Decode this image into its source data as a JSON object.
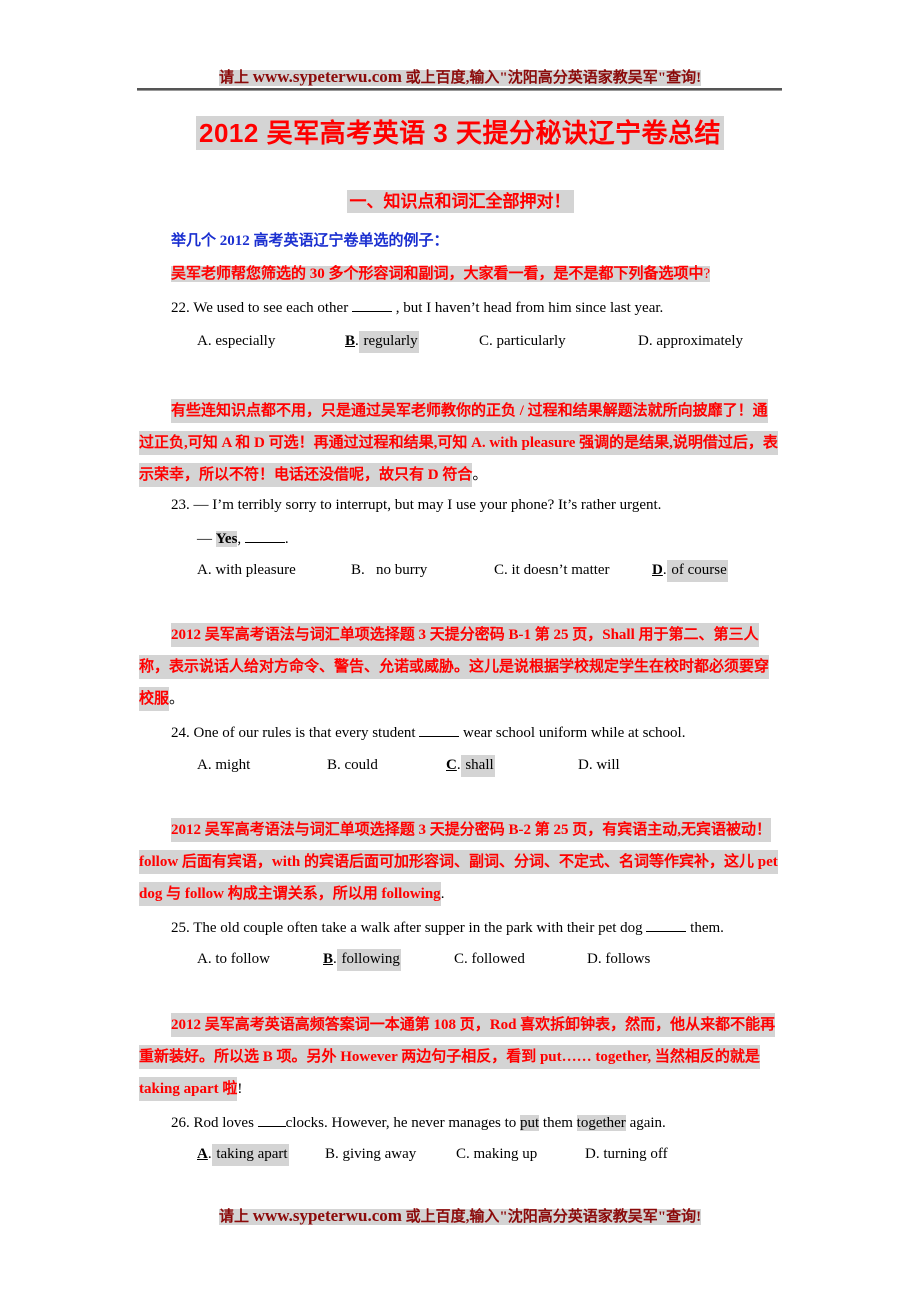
{
  "header": {
    "prefix": "请上 ",
    "url": "www.sypeterwu.com",
    "suffix": " 或上百度,输入\"沈阳高分英语家教吴军\"查询!"
  },
  "title": "2012 吴军高考英语 3 天提分秘诀辽宁卷总结",
  "section_heading": "一、知识点和词汇全部押对！",
  "intro": "举几个 2012 高考英语辽宁卷单选的例子：",
  "intro2": {
    "text": "吴军老师帮您筛选的 30 多个形容词和副词，大家看一看，是不是都下列备选项中",
    "end": "?"
  },
  "questions": [
    {
      "number": "22.",
      "stem_before": "We used to see each other ",
      "stem_after": " , but I haven’t head from him since last year.",
      "options": [
        {
          "letter": "A",
          "text": "especially",
          "correct": false
        },
        {
          "letter": "B",
          "text": "regularly",
          "correct": true
        },
        {
          "letter": "C",
          "text": "particularly",
          "correct": false
        },
        {
          "letter": "D",
          "text": "approximately",
          "correct": false
        }
      ],
      "explanation": {
        "text": "有些连知识点都不用，只是通过吴军老师教你的正负 / 过程和结果解题法就所向披靡了！通过正负,可知 A 和 D 可选！再通过过程和结果,可知 A. with pleasure 强调的是结果,说明借过后，表示荣幸，所以不符！电话还没借呢，故只有 D 符合",
        "tail": "。"
      }
    },
    {
      "number": "23.",
      "stem_line1": "— I’m terribly sorry to interrupt, but may I use your phone? It’s rather urgent.",
      "stem_line2_dash": "— ",
      "stem_line2_bold": "Yes",
      "stem_line2_after": ", ",
      "stem_line2_end": ".",
      "options": [
        {
          "letter": "A",
          "text": "with pleasure",
          "correct": false
        },
        {
          "letter": "B",
          "text": "   no burry",
          "correct": false
        },
        {
          "letter": "C",
          "text": "it doesn’t matter",
          "correct": false
        },
        {
          "letter": "D",
          "text": "of course",
          "correct": true
        }
      ],
      "explanation": {
        "text": "2012 吴军高考语法与词汇单项选择题 3 天提分密码 B-1 第 25 页，Shall 用于第二、第三人称，表示说话人给对方命令、警告、允诺或威胁。这儿是说根据学校规定学生在校时都必须要穿校服",
        "tail": "。"
      }
    },
    {
      "number": "24.",
      "stem_before": "One of our rules is that every student ",
      "stem_after": " wear school uniform while at school.",
      "options": [
        {
          "letter": "A",
          "text": "might",
          "correct": false
        },
        {
          "letter": "B",
          "text": "could",
          "correct": false
        },
        {
          "letter": "C",
          "text": "shall",
          "correct": true
        },
        {
          "letter": "D",
          "text": "will",
          "correct": false
        }
      ],
      "explanation": {
        "text": "2012 吴军高考语法与词汇单项选择题 3 天提分密码 B-2 第 25 页，有宾语主动,无宾语被动！follow 后面有宾语，with 的宾语后面可加形容词、副词、分词、不定式、名词等作宾补，这儿 pet dog 与 follow 构成主谓关系，所以用 following",
        "tail": "."
      }
    },
    {
      "number": "25.",
      "stem_before": "The old couple often take a walk after supper in the park with their pet dog ",
      "stem_after": " them.",
      "options": [
        {
          "letter": "A",
          "text": "to follow",
          "correct": false
        },
        {
          "letter": "B",
          "text": "following",
          "correct": true
        },
        {
          "letter": "C",
          "text": "followed",
          "correct": false
        },
        {
          "letter": "D",
          "text": "follows",
          "correct": false
        }
      ],
      "explanation": {
        "text": "2012 吴军高考英语高频答案词一本通第 108 页，Rod 喜欢拆卸钟表，然而，他从来都不能再重新装好。所以选 B 项。另外 However 两边句子相反，看到 put…… together, 当然相反的就是 taking apart 啦",
        "tail": "!"
      }
    },
    {
      "number": "26.",
      "stem_before": "Rod loves ",
      "stem_mid1": "clocks. However, he never manages to ",
      "stem_hl1": "put",
      "stem_mid2": " them ",
      "stem_hl2": "together",
      "stem_after": " again.",
      "options": [
        {
          "letter": "A",
          "text": "taking apart",
          "correct": true
        },
        {
          "letter": "B",
          "text": "giving away",
          "correct": false
        },
        {
          "letter": "C",
          "text": "making up",
          "correct": false
        },
        {
          "letter": "D",
          "text": "turning off",
          "correct": false
        }
      ]
    }
  ],
  "footer": {
    "prefix": "请上 ",
    "url": "www.sypeterwu.com",
    "suffix": " 或上百度,输入\"沈阳高分英语家教吴军\"查询!"
  }
}
